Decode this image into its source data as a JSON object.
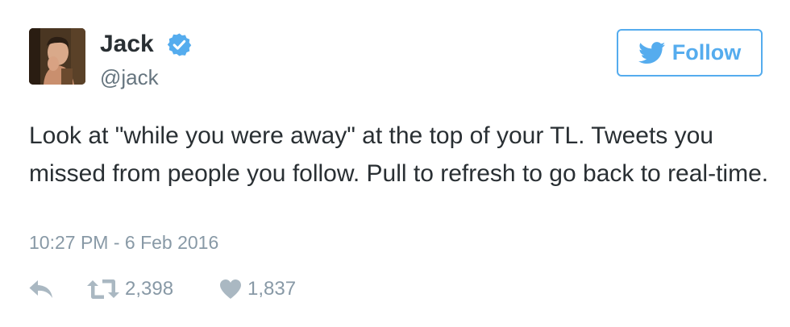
{
  "author": {
    "name": "Jack",
    "handle": "@jack",
    "verified": true
  },
  "follow_button": {
    "label": "Follow",
    "icon": "twitter-bird-icon"
  },
  "tweet": {
    "text": "Look at \"while you were away\" at the top of your TL. Tweets you missed from people you follow. Pull to refresh to go back to real-time.",
    "timestamp": "10:27 PM - 6 Feb 2016"
  },
  "actions": {
    "reply_icon": "reply-icon",
    "retweet_icon": "retweet-icon",
    "retweet_count": "2,398",
    "like_icon": "heart-icon",
    "like_count": "1,837"
  },
  "colors": {
    "accent": "#55acee",
    "text": "#292f33",
    "muted": "#8899a6",
    "action_icon": "#aab8c2"
  }
}
